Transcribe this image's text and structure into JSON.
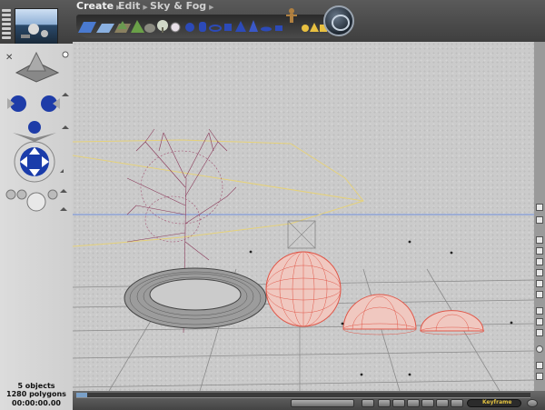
{
  "menu": {
    "create_label": "Create",
    "edit_label": "Edit",
    "sky_fog_label": "Sky & Fog"
  },
  "status": {
    "objects": "5 objects",
    "polygons": "1280 polygons",
    "time": "00:00:00.00"
  },
  "palette_icons": [
    "infinite-plane-icon",
    "water-plane-icon",
    "cloud-plane-icon",
    "terrain-icon",
    "stone-icon",
    "tree-icon",
    "symmetrical-lattice-icon",
    "sphere-icon",
    "cylinder-icon",
    "torus-icon",
    "cube-icon",
    "pyramid-icon",
    "cone-icon",
    "disk-icon",
    "square-icon",
    "poser-figure-icon",
    "radial-light-icon",
    "spot-light-icon",
    "square-spot-light-icon",
    "parallel-light-icon"
  ],
  "bottom": {
    "keyframe_label": "Keyframe"
  },
  "colors": {
    "viewport": "#cbcbcb",
    "sphere_wire": "#e0584a",
    "torus_wire": "#555555",
    "tree_wire": "#8a3a5a",
    "horizon_line": "#6f8fdc",
    "selection_outline": "#e6d27a"
  }
}
